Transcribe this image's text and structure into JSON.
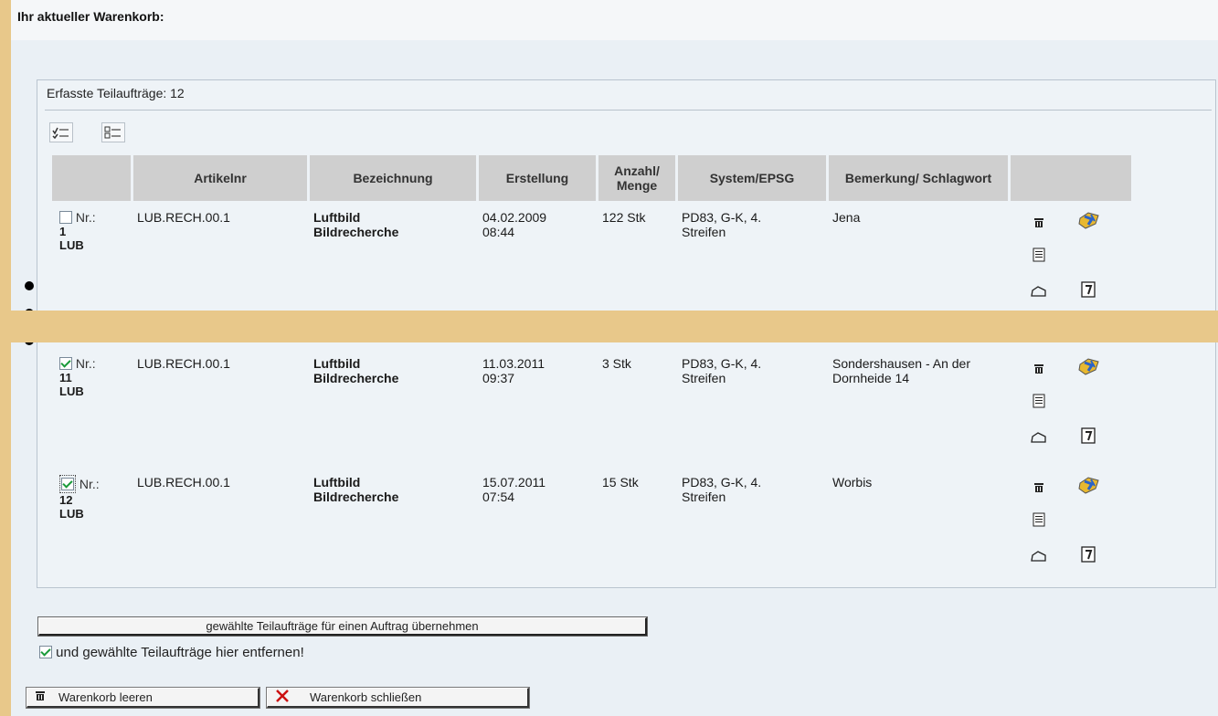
{
  "heading": "Ihr aktueller Warenkorb:",
  "panel": {
    "caption": "Erfasste Teilaufträge: 12",
    "columns": [
      "",
      "Artikelnr",
      "Bezeichnung",
      "Erstellung",
      "Anzahl/ Menge",
      "System/EPSG",
      "Bemerkung/ Schlagwort",
      ""
    ]
  },
  "rows": [
    {
      "checked": false,
      "nr_label": "Nr.:",
      "nr": "1",
      "type": "LUB",
      "artikelnr": "LUB.RECH.00.1",
      "bezeichnung_1": "Luftbild",
      "bezeichnung_2": "Bildrecherche",
      "erstellung_datum": "04.02.2009",
      "erstellung_zeit": "08:44",
      "menge": "122 Stk",
      "system_1": "PD83, G-K, 4.",
      "system_2": "Streifen",
      "bemerkung": "Jena"
    },
    {
      "checked": true,
      "nr_label": "Nr.:",
      "nr": "11",
      "type": "LUB",
      "artikelnr": "LUB.RECH.00.1",
      "bezeichnung_1": "Luftbild",
      "bezeichnung_2": "Bildrecherche",
      "erstellung_datum": "11.03.2011",
      "erstellung_zeit": "09:37",
      "menge": "3 Stk",
      "system_1": "PD83, G-K, 4.",
      "system_2": "Streifen",
      "bemerkung": "Sondershausen - An der Dornheide 14"
    },
    {
      "checked": true,
      "nr_label": "Nr.:",
      "nr": "12",
      "type": "LUB",
      "artikelnr": "LUB.RECH.00.1",
      "bezeichnung_1": "Luftbild",
      "bezeichnung_2": "Bildrecherche",
      "erstellung_datum": "15.07.2011",
      "erstellung_zeit": "07:54",
      "menge": "15 Stk",
      "system_1": "PD83, G-K, 4.",
      "system_2": "Streifen",
      "bemerkung": "Worbis"
    }
  ],
  "actions": {
    "take_button": "gewählte Teilaufträge für einen Auftrag übernehmen",
    "remove_checked": true,
    "remove_label": "und gewählte Teilaufträge hier entfernen!",
    "clear_button": "Warenkorb leeren",
    "close_button": "Warenkorb schließen"
  },
  "colors": {
    "background_band": "#e8c88a",
    "page_bg": "#eaf0f5",
    "header_bg": "#cfcfcf",
    "check_green": "#1a9a3a",
    "close_red": "#cc1111"
  },
  "icons": [
    "check-all-icon",
    "uncheck-all-icon",
    "trash-icon",
    "map-pin-icon",
    "document-icon",
    "edit-icon",
    "note-icon"
  ]
}
